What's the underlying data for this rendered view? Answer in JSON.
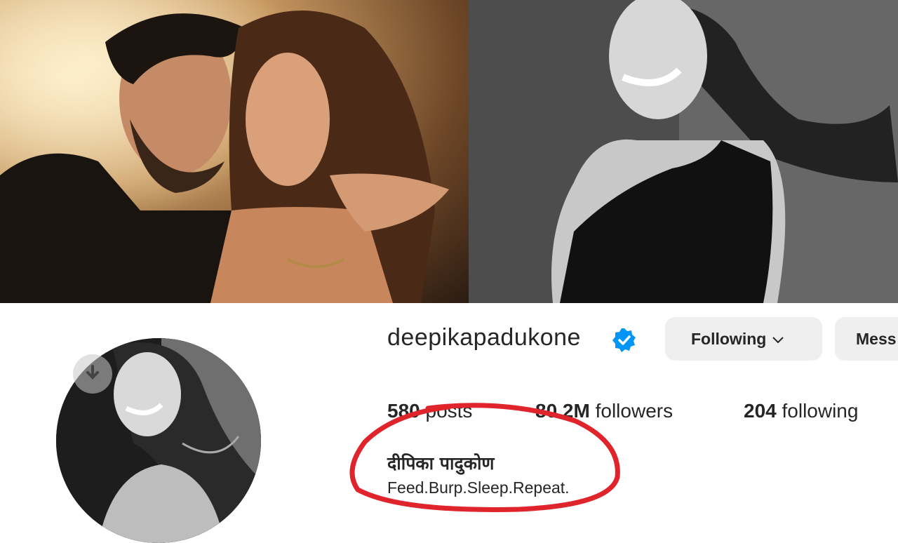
{
  "profile": {
    "username": "deepikapadukone",
    "verified": true,
    "full_name": "दीपिका पादुकोण",
    "bio": "Feed.Burp.Sleep.Repeat."
  },
  "actions": {
    "following_label": "Following",
    "message_label": "Mess"
  },
  "stats": {
    "posts_value": "580",
    "posts_label": "posts",
    "followers_value": "80.2M",
    "followers_label": "followers",
    "following_value": "204",
    "following_label": "following"
  },
  "icons": {
    "verified": "verified-badge-icon",
    "chevron": "chevron-down-icon",
    "download": "download-icon"
  },
  "colors": {
    "verified_blue": "#0095f6",
    "annotation_red": "#e0242c",
    "button_bg": "#efefef",
    "text": "#262626"
  }
}
